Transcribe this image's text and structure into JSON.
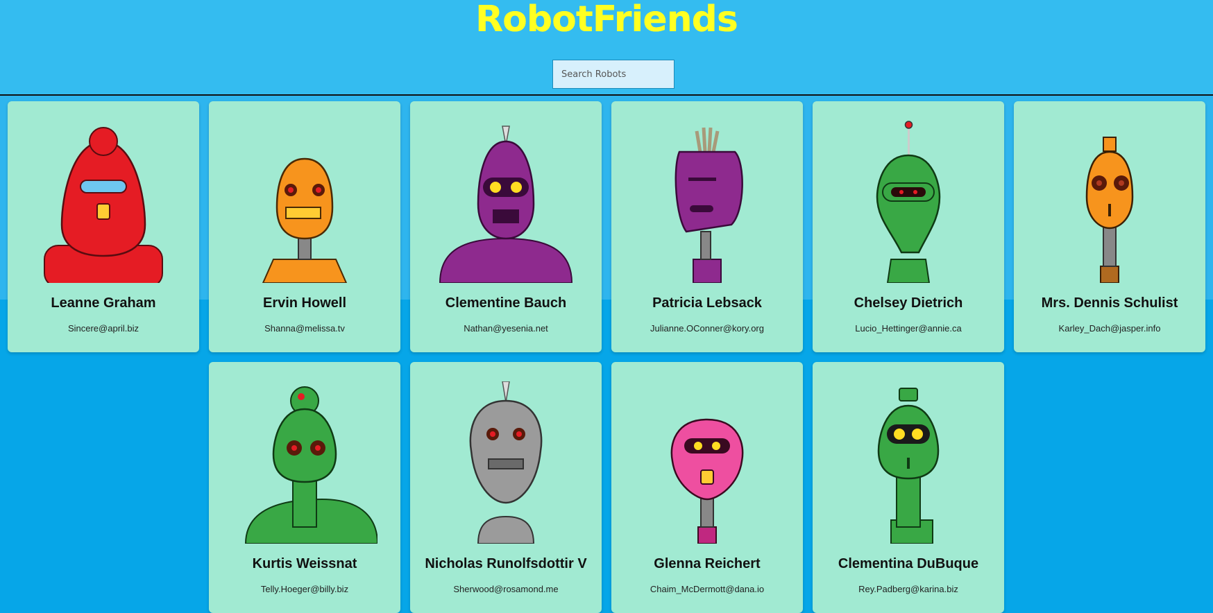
{
  "app": {
    "title": "RobotFriends"
  },
  "search": {
    "placeholder": "Search Robots"
  },
  "robots": [
    {
      "name": "Leanne Graham",
      "email": "Sincere@april.biz",
      "color": "#e51c24"
    },
    {
      "name": "Ervin Howell",
      "email": "Shanna@melissa.tv",
      "color": "#f7941d"
    },
    {
      "name": "Clementine Bauch",
      "email": "Nathan@yesenia.net",
      "color": "#8e2a8e"
    },
    {
      "name": "Patricia Lebsack",
      "email": "Julianne.OConner@kory.org",
      "color": "#8e2a8e"
    },
    {
      "name": "Chelsey Dietrich",
      "email": "Lucio_Hettinger@annie.ca",
      "color": "#39a845"
    },
    {
      "name": "Mrs. Dennis Schulist",
      "email": "Karley_Dach@jasper.info",
      "color": "#f7941d"
    },
    {
      "name": "Kurtis Weissnat",
      "email": "Telly.Hoeger@billy.biz",
      "color": "#39a845"
    },
    {
      "name": "Nicholas Runolfsdottir V",
      "email": "Sherwood@rosamond.me",
      "color": "#9b9b9b"
    },
    {
      "name": "Glenna Reichert",
      "email": "Chaim_McDermott@dana.io",
      "color": "#ee4fa0"
    },
    {
      "name": "Clementina DuBuque",
      "email": "Rey.Padberg@karina.biz",
      "color": "#39a845"
    }
  ]
}
